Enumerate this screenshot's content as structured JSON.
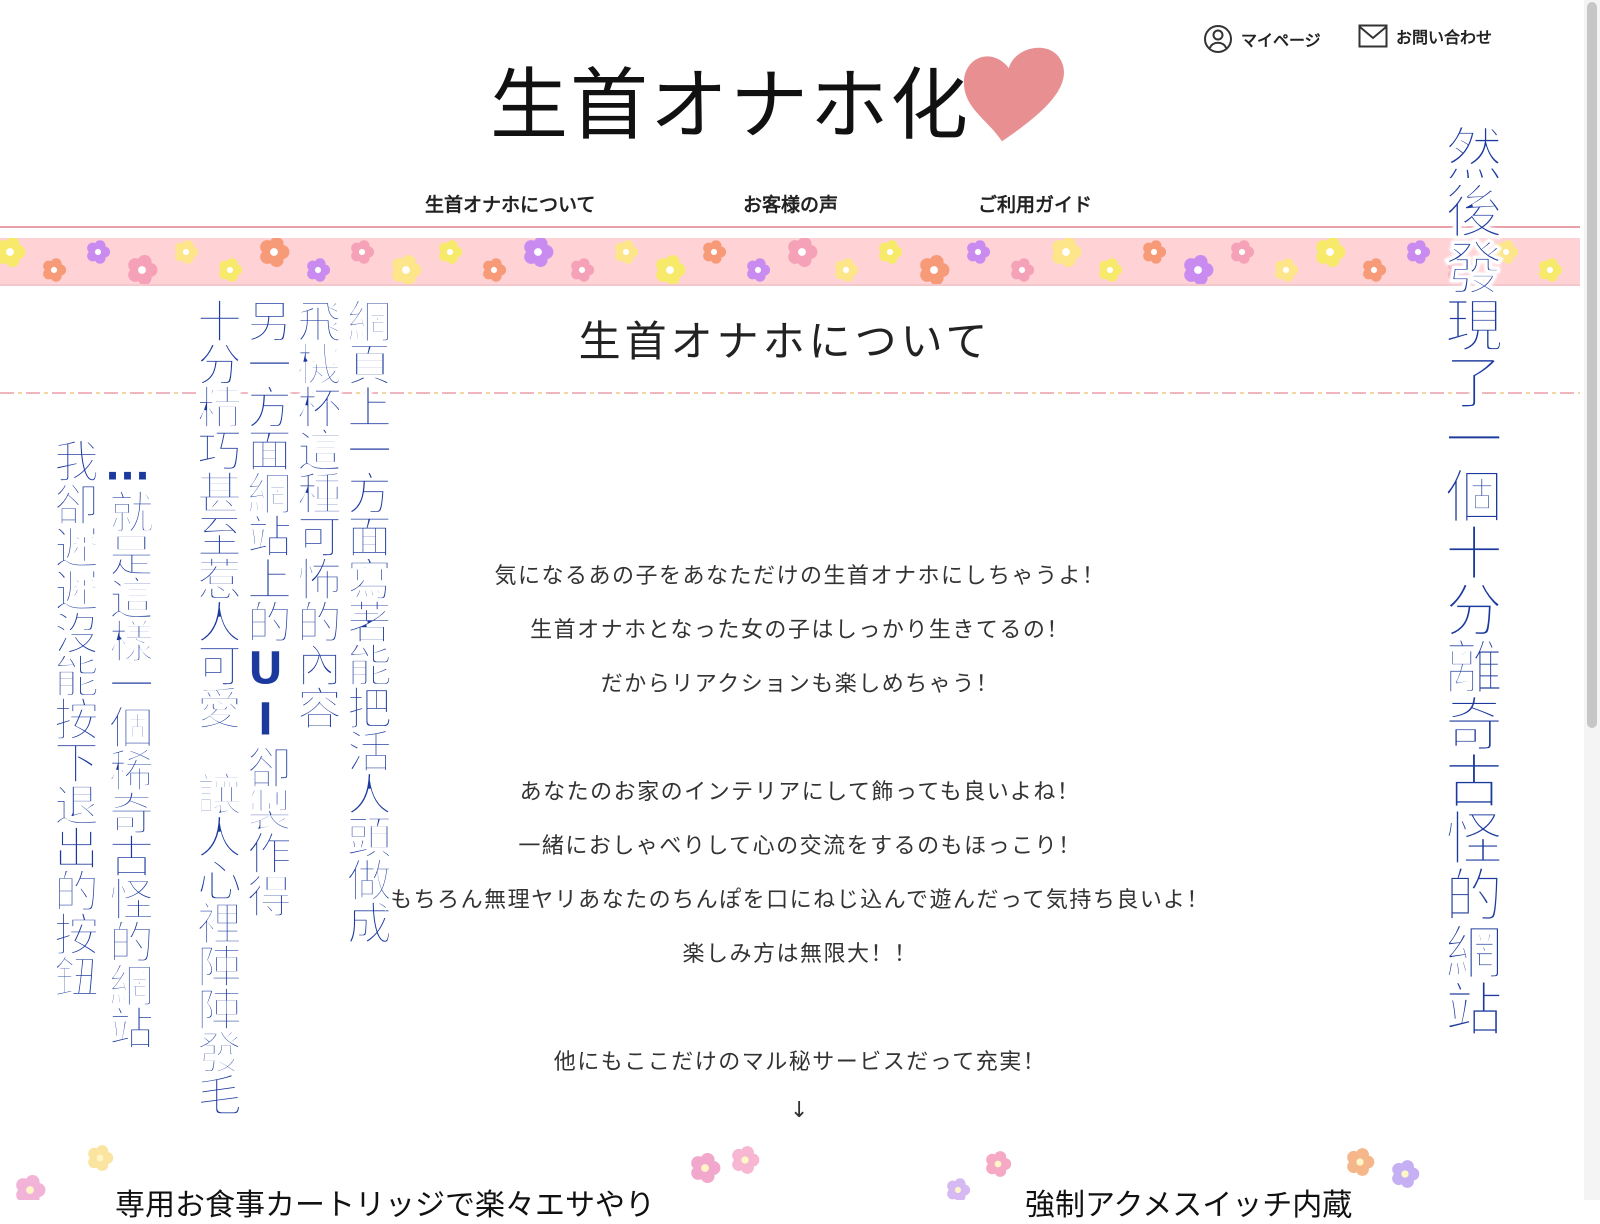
{
  "header": {
    "mypage_label": "マイページ",
    "contact_label": "お問い合わせ",
    "logo_text": "生首オナホ化"
  },
  "nav": {
    "items": [
      {
        "label": "生首オナホについて"
      },
      {
        "label": "お客様の声"
      },
      {
        "label": "ご利用ガイド"
      }
    ]
  },
  "section": {
    "title": "生首オナホについて",
    "paragraphs": [
      "気になるあの子をあなただけの生首オナホにしちゃうよ！",
      "生首オナホとなった女の子はしっかり生きてるの！",
      "だからリアクションも楽しめちゃう！",
      "あなたのお家のインテリアにして飾っても良いよね！",
      "一緒におしゃべりして心の交流をするのもほっこり！",
      "もちろん無理ヤリあなたのちんぽを口にねじ込んで遊んだって気持ち良いよ！",
      "楽しみ方は無限大！！",
      "他にもここだけのマル秘サービスだって充実！",
      "↓"
    ]
  },
  "teasers": [
    {
      "label": "専用お食事カートリッジで楽々エサやり"
    },
    {
      "label": "強制アクメスイッチ内蔵"
    }
  ],
  "overlay_captions": {
    "right": "然後發現了一個十分離奇古怪的網站",
    "col1": "網頁上一方面寫著能把活人頭做成",
    "col2": "飛機杯這種可怖的內容",
    "col3": "另一方面網站上的UI卻製作得",
    "col4": "十分精巧甚至惹人可愛　讓人心裡陣陣發毛",
    "col5": "…就是這樣一個稀奇古怪的網站",
    "col6": "我卻遲遲沒能按下退出的按鈕"
  },
  "colors": {
    "caption_blue": "#1c3a9e",
    "band_pink": "#ffd2d6",
    "heart": "#e88f92"
  },
  "icons": [
    "user-icon",
    "mail-icon",
    "heart-icon",
    "flower-icon"
  ]
}
